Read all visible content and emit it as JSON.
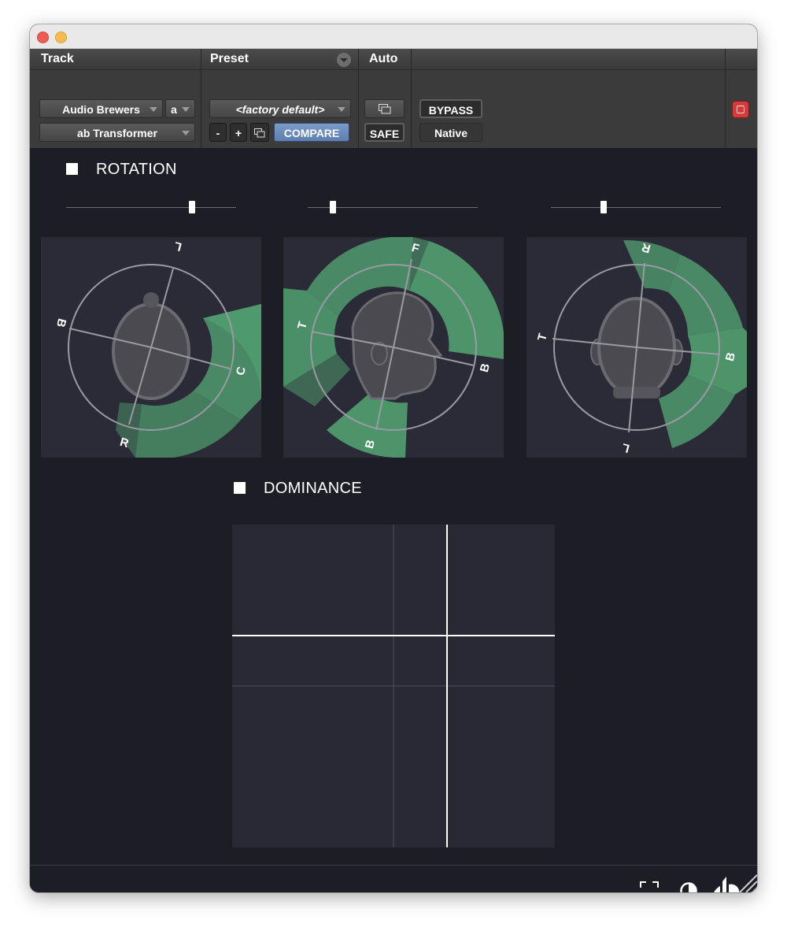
{
  "header": {
    "track_label": "Track",
    "preset_label": "Preset",
    "auto_label": "Auto",
    "track_name": "Audio Brewers",
    "channel": "a",
    "plugin_name": "ab Transformer",
    "preset_name": "<factory default>",
    "minus_label": "-",
    "plus_label": "+",
    "compare_label": "COMPARE",
    "safe_label": "SAFE",
    "bypass_label": "BYPASS",
    "native_label": "Native"
  },
  "rotation": {
    "title": "ROTATION",
    "sliders": [
      0.74,
      0.15,
      0.31
    ],
    "panels": [
      {
        "labels": [
          "L",
          "B",
          "C",
          "R"
        ]
      },
      {
        "labels": [
          "F",
          "T",
          "B",
          "B"
        ]
      },
      {
        "labels": [
          "R",
          "T",
          "B",
          "L"
        ]
      }
    ]
  },
  "dominance": {
    "title": "DOMINANCE"
  },
  "colors": {
    "accent_green": "#4f9a6e",
    "background": "#1d1e25",
    "panel": "#2a2b36",
    "compare_blue": "#6b8cbd",
    "bypass_red": "#d33b3b"
  },
  "icons": [
    "fullscreen-icon",
    "contrast-icon",
    "audio-brewers-logo-icon"
  ]
}
